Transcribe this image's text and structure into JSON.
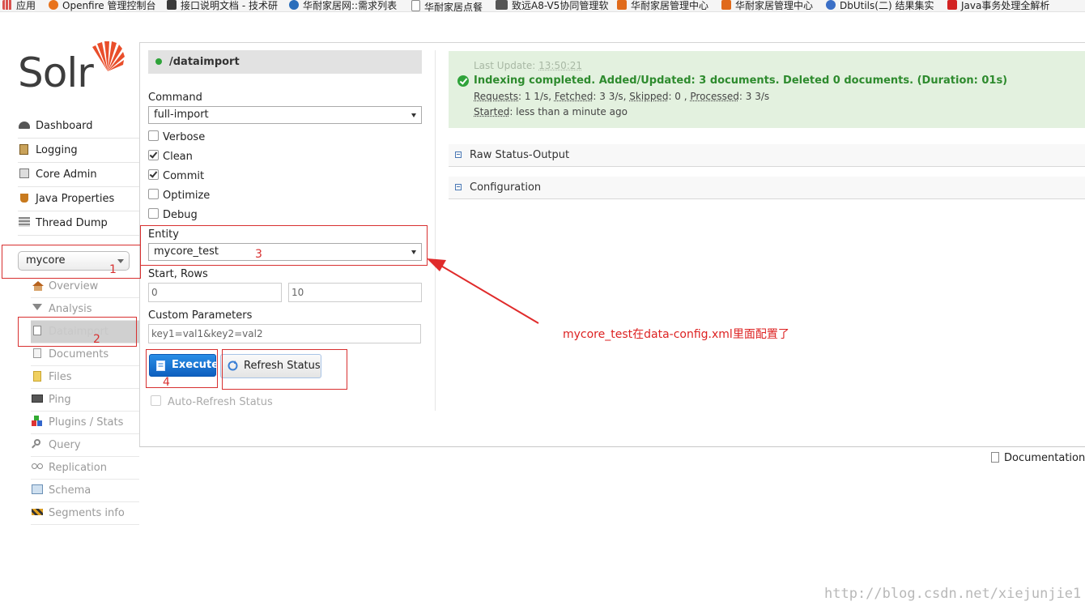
{
  "bookmarks": [
    {
      "label": "应用",
      "color": "#d9534f"
    },
    {
      "label": "Openfire 管理控制台",
      "color": "#e8731c"
    },
    {
      "label": "接口说明文档 - 技术研",
      "color": "#3a3a3a"
    },
    {
      "label": "华耐家居网::需求列表",
      "color": "#2a6ebb"
    },
    {
      "label": "华耐家居点餐",
      "color": "#888888"
    },
    {
      "label": "致远A8-V5协同管理软",
      "color": "#555555"
    },
    {
      "label": "华耐家居管理中心",
      "color": "#e06a1b"
    },
    {
      "label": "华耐家居管理中心",
      "color": "#e06a1b"
    },
    {
      "label": "DbUtils(二) 结果集实",
      "color": "#3b6fc6"
    },
    {
      "label": "Java事务处理全解析",
      "color": "#d22222"
    }
  ],
  "logo": {
    "text": "Solr"
  },
  "nav": {
    "items": [
      {
        "label": "Dashboard",
        "icon": "dashboard-icon"
      },
      {
        "label": "Logging",
        "icon": "logging-icon"
      },
      {
        "label": "Core Admin",
        "icon": "core-admin-icon"
      },
      {
        "label": "Java Properties",
        "icon": "java-properties-icon"
      },
      {
        "label": "Thread Dump",
        "icon": "thread-dump-icon"
      }
    ],
    "core_selected": "mycore",
    "core_items": [
      {
        "label": "Overview",
        "icon": "overview-icon"
      },
      {
        "label": "Analysis",
        "icon": "analysis-icon"
      },
      {
        "label": "Dataimport",
        "icon": "dataimport-icon"
      },
      {
        "label": "Documents",
        "icon": "documents-icon"
      },
      {
        "label": "Files",
        "icon": "files-icon"
      },
      {
        "label": "Ping",
        "icon": "ping-icon"
      },
      {
        "label": "Plugins / Stats",
        "icon": "plugins-icon"
      },
      {
        "label": "Query",
        "icon": "query-icon"
      },
      {
        "label": "Replication",
        "icon": "replication-icon"
      },
      {
        "label": "Schema",
        "icon": "schema-icon"
      },
      {
        "label": "Segments info",
        "icon": "segments-icon"
      }
    ]
  },
  "form": {
    "handler": "/dataimport",
    "command_label": "Command",
    "command_value": "full-import",
    "options": [
      {
        "label": "Verbose",
        "checked": false
      },
      {
        "label": "Clean",
        "checked": true
      },
      {
        "label": "Commit",
        "checked": true
      },
      {
        "label": "Optimize",
        "checked": false
      },
      {
        "label": "Debug",
        "checked": false
      }
    ],
    "entity_label": "Entity",
    "entity_value": "mycore_test",
    "start_rows_label": "Start, Rows",
    "start_value": "0",
    "rows_value": "10",
    "custom_params_label": "Custom Parameters",
    "custom_params_value": "key1=val1&key2=val2",
    "execute_label": "Execute",
    "refresh_label": "Refresh Status",
    "auto_refresh_label": "Auto-Refresh Status"
  },
  "status": {
    "last_update_label": "Last Update:",
    "last_update_value": "13:50:21",
    "main": "Indexing completed. Added/Updated: 3 documents. Deleted 0 documents. (Duration: 01s)",
    "requests_key": "Requests",
    "requests_val": ": 1 1/s, ",
    "fetched_key": "Fetched",
    "fetched_val": ": 3 3/s, ",
    "skipped_key": "Skipped",
    "skipped_val": ": 0 , ",
    "processed_key": "Processed",
    "processed_val": ": 3 3/s",
    "started_key": "Started",
    "started_val": ": less than a minute ago"
  },
  "sections": {
    "raw": "Raw Status-Output",
    "config": "Configuration"
  },
  "annotations": {
    "n1": "1",
    "n2": "2",
    "n3": "3",
    "n4": "4",
    "note": "mycore_test在data-config.xml里面配置了"
  },
  "footer": {
    "documentation": "Documentation",
    "watermark": "http://blog.csdn.net/xiejunjie1"
  },
  "colors": {
    "accent_red": "#d83030",
    "status_green": "#2fa33a",
    "execute_blue": "#1a72d4"
  }
}
